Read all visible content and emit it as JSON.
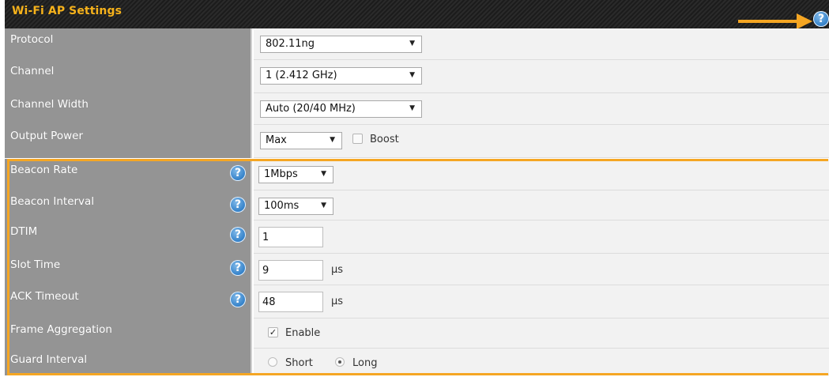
{
  "header": {
    "title": "Wi-Fi AP Settings",
    "help_icon": "help-icon"
  },
  "accent_color": "#f5a623",
  "rows": {
    "protocol": {
      "label": "Protocol",
      "value": "802.11ng"
    },
    "channel": {
      "label": "Channel",
      "value": "1 (2.412 GHz)"
    },
    "channel_width": {
      "label": "Channel Width",
      "value": "Auto (20/40 MHz)"
    },
    "output_power": {
      "label": "Output Power",
      "value": "Max",
      "boost_label": "Boost",
      "boost_checked": false
    },
    "beacon_rate": {
      "label": "Beacon Rate",
      "value": "1Mbps"
    },
    "beacon_interval": {
      "label": "Beacon Interval",
      "value": "100ms"
    },
    "dtim": {
      "label": "DTIM",
      "value": "1"
    },
    "slot_time": {
      "label": "Slot Time",
      "value": "9",
      "unit": "μs"
    },
    "ack_timeout": {
      "label": "ACK Timeout",
      "value": "48",
      "unit": "μs"
    },
    "frame_aggregation": {
      "label": "Frame Aggregation",
      "enable_label": "Enable",
      "enabled": true
    },
    "guard_interval": {
      "label": "Guard Interval",
      "options": [
        "Short",
        "Long"
      ],
      "selected": "Long"
    }
  }
}
